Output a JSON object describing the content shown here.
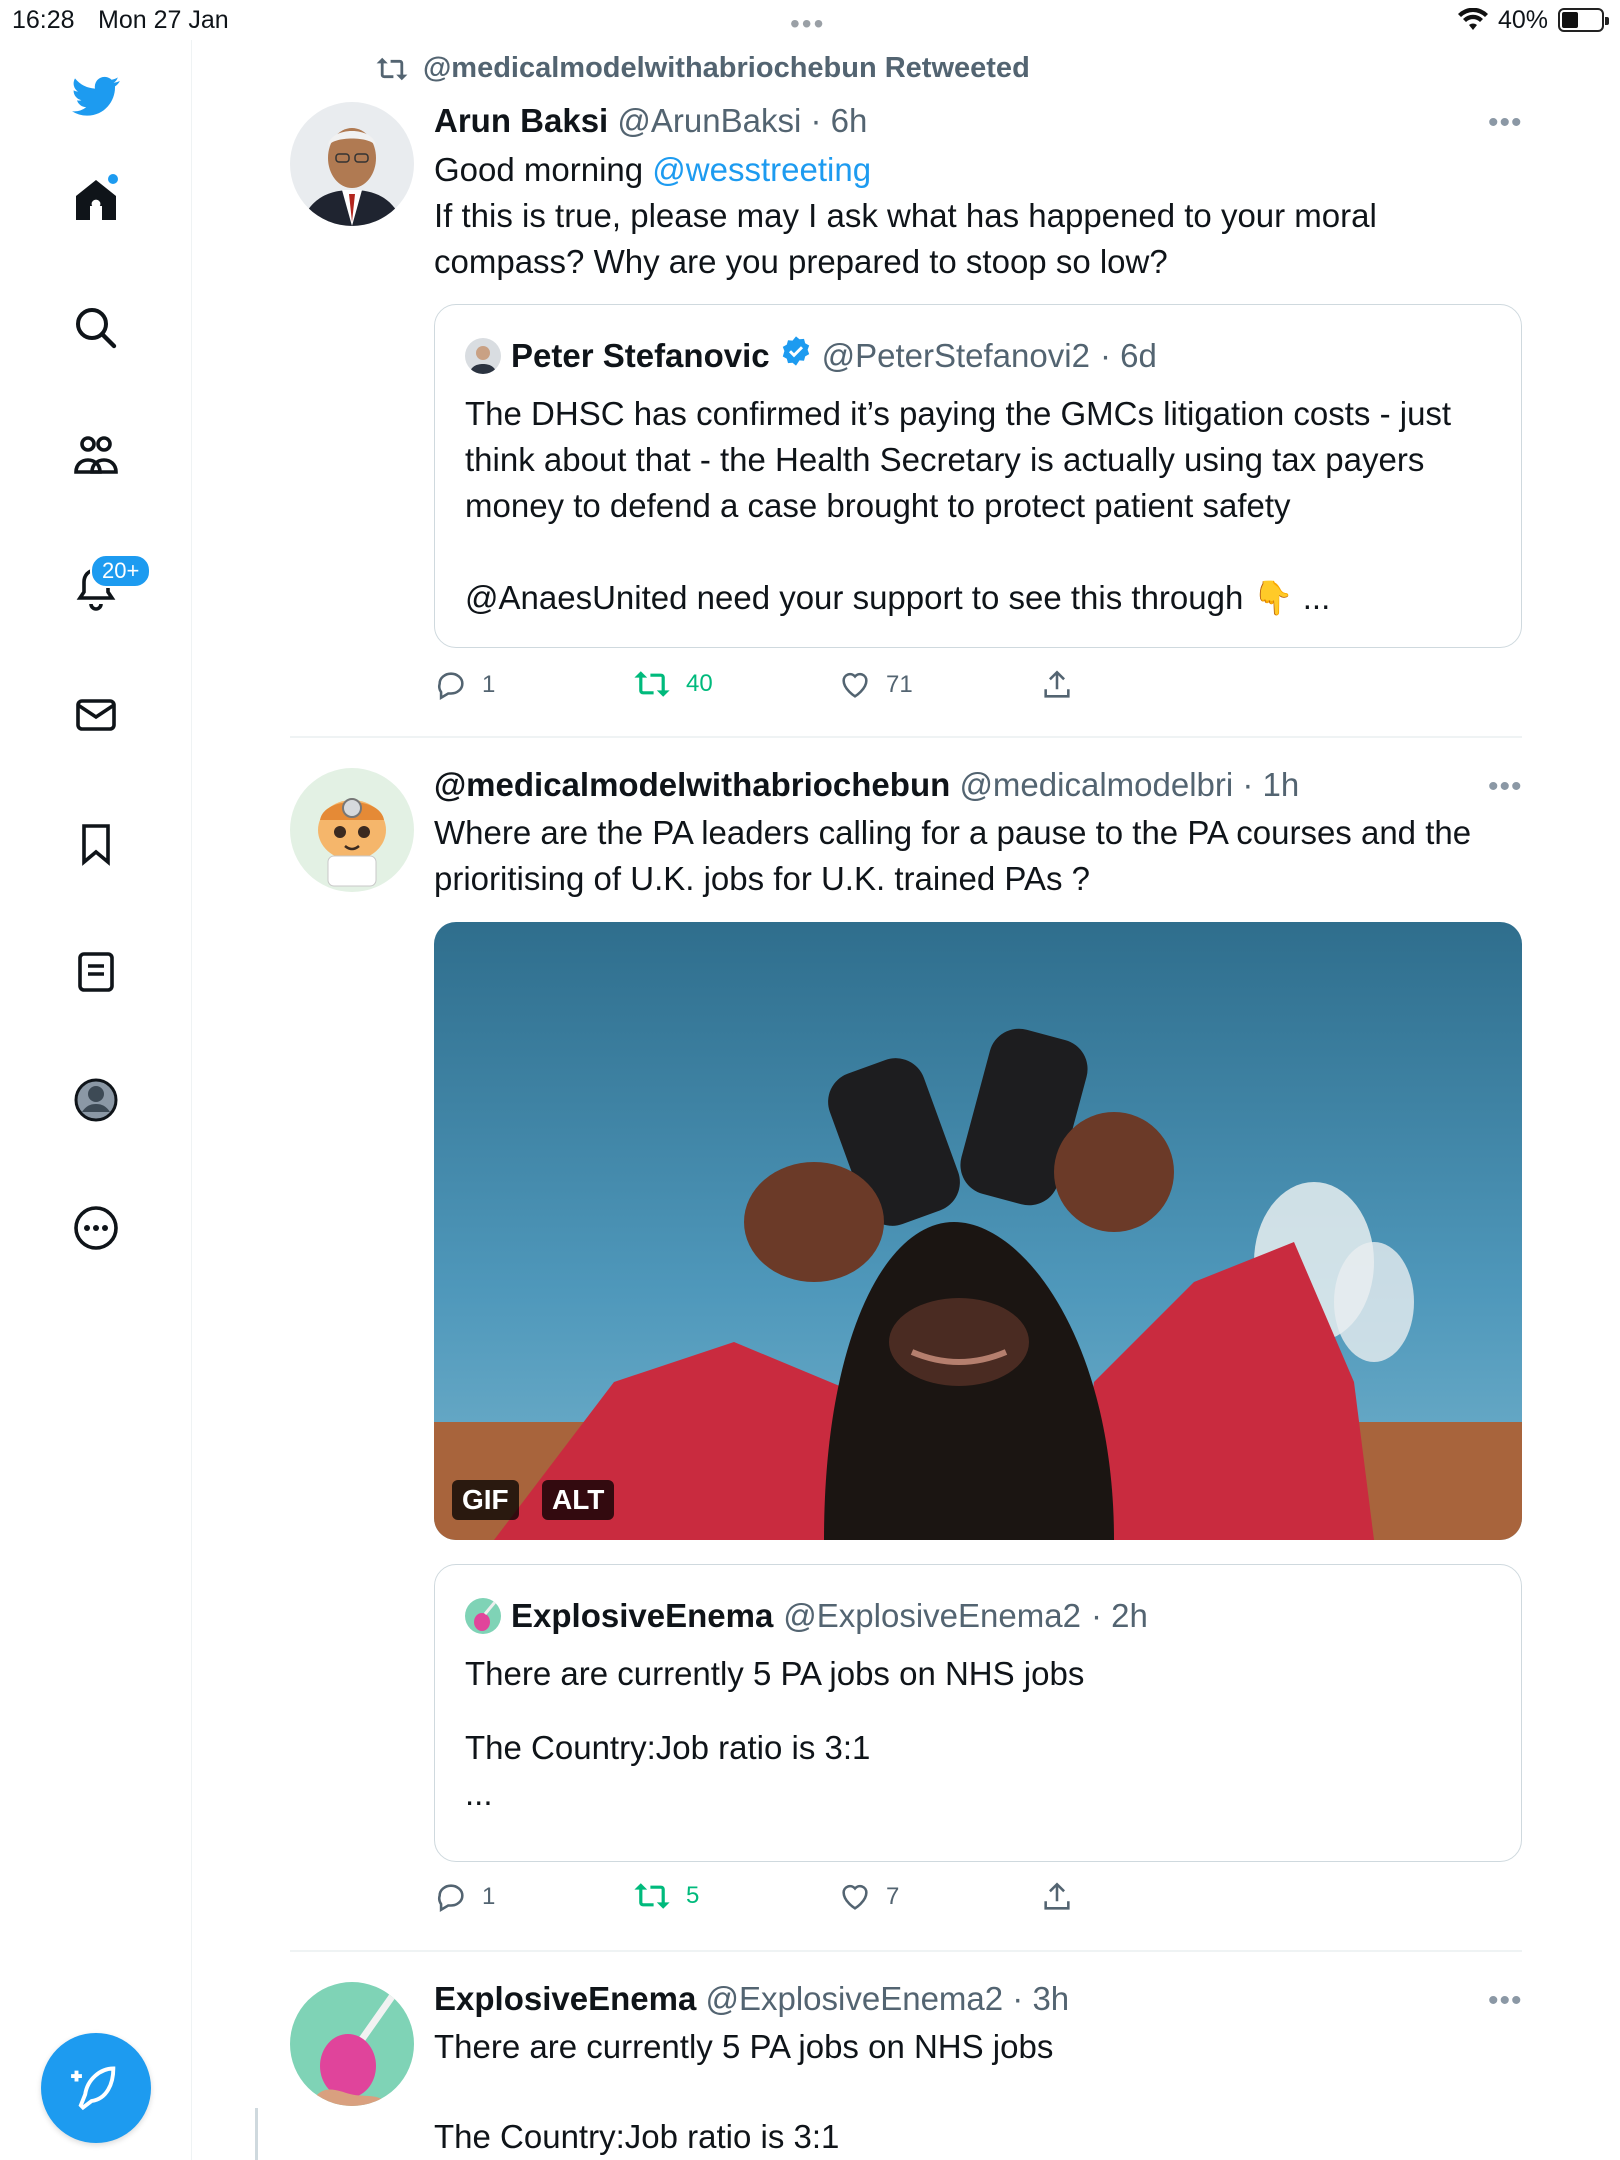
{
  "status_bar": {
    "time": "16:28",
    "date": "Mon 27 Jan",
    "dots": "•••",
    "battery": "40%"
  },
  "sidebar": {
    "notifications_badge": "20+",
    "items": [
      "twitter-logo",
      "home",
      "search",
      "communities",
      "notifications",
      "messages",
      "bookmarks",
      "lists",
      "profile",
      "more"
    ]
  },
  "retweet_banner": "@medicalmodelwithabriochebun Retweeted",
  "tweets": [
    {
      "name": "Arun Baksi",
      "handle": "@ArunBaksi",
      "time": "· 6h",
      "greeting": "Good morning",
      "mention": "@wesstreeting",
      "line1": "If this is true, please may I ask what has happened to your moral",
      "line2": "compass? Why are you prepared to stoop so low?",
      "quote": {
        "name": "Peter Stefanovic",
        "handle": "@PeterStefanovi2",
        "time": "· 6d",
        "line1": "The DHSC has confirmed it’s paying the GMCs litigation costs - just",
        "line2": "think about that - the Health Secretary is actually using tax payers",
        "line3": "money to defend a case brought to protect patient safety",
        "line4": "@AnaesUnited need your support to see this through",
        "emoji": "👇",
        "ellipsis": "..."
      },
      "replies": "1",
      "retweets": "40",
      "likes": "71"
    },
    {
      "name": "@medicalmodelwithabriochebun",
      "handle": "@medicalmodelbri",
      "time": "· 1h",
      "line1": "Where are the PA leaders calling for a pause to the PA courses and the",
      "line2": "prioritising of U.K. jobs for U.K. trained PAs ?",
      "media_gif_tag": "GIF",
      "media_alt_tag": "ALT",
      "quote": {
        "name": "ExplosiveEnema",
        "handle": "@ExplosiveEnema2",
        "time": "· 2h",
        "line1": "There are currently 5 PA jobs on NHS jobs",
        "line2": "The Country:Job ratio is 3:1",
        "ellipsis": "..."
      },
      "replies": "1",
      "retweets": "5",
      "likes": "7"
    },
    {
      "name": "ExplosiveEnema",
      "handle": "@ExplosiveEnema2",
      "time": "· 3h",
      "line1": "There are currently 5 PA jobs on NHS jobs",
      "line2": "The Country:Job ratio is 3:1"
    }
  ],
  "colors": {
    "accent": "#1d9bf0",
    "retweet_green": "#00ba7c",
    "muted": "#536471"
  }
}
